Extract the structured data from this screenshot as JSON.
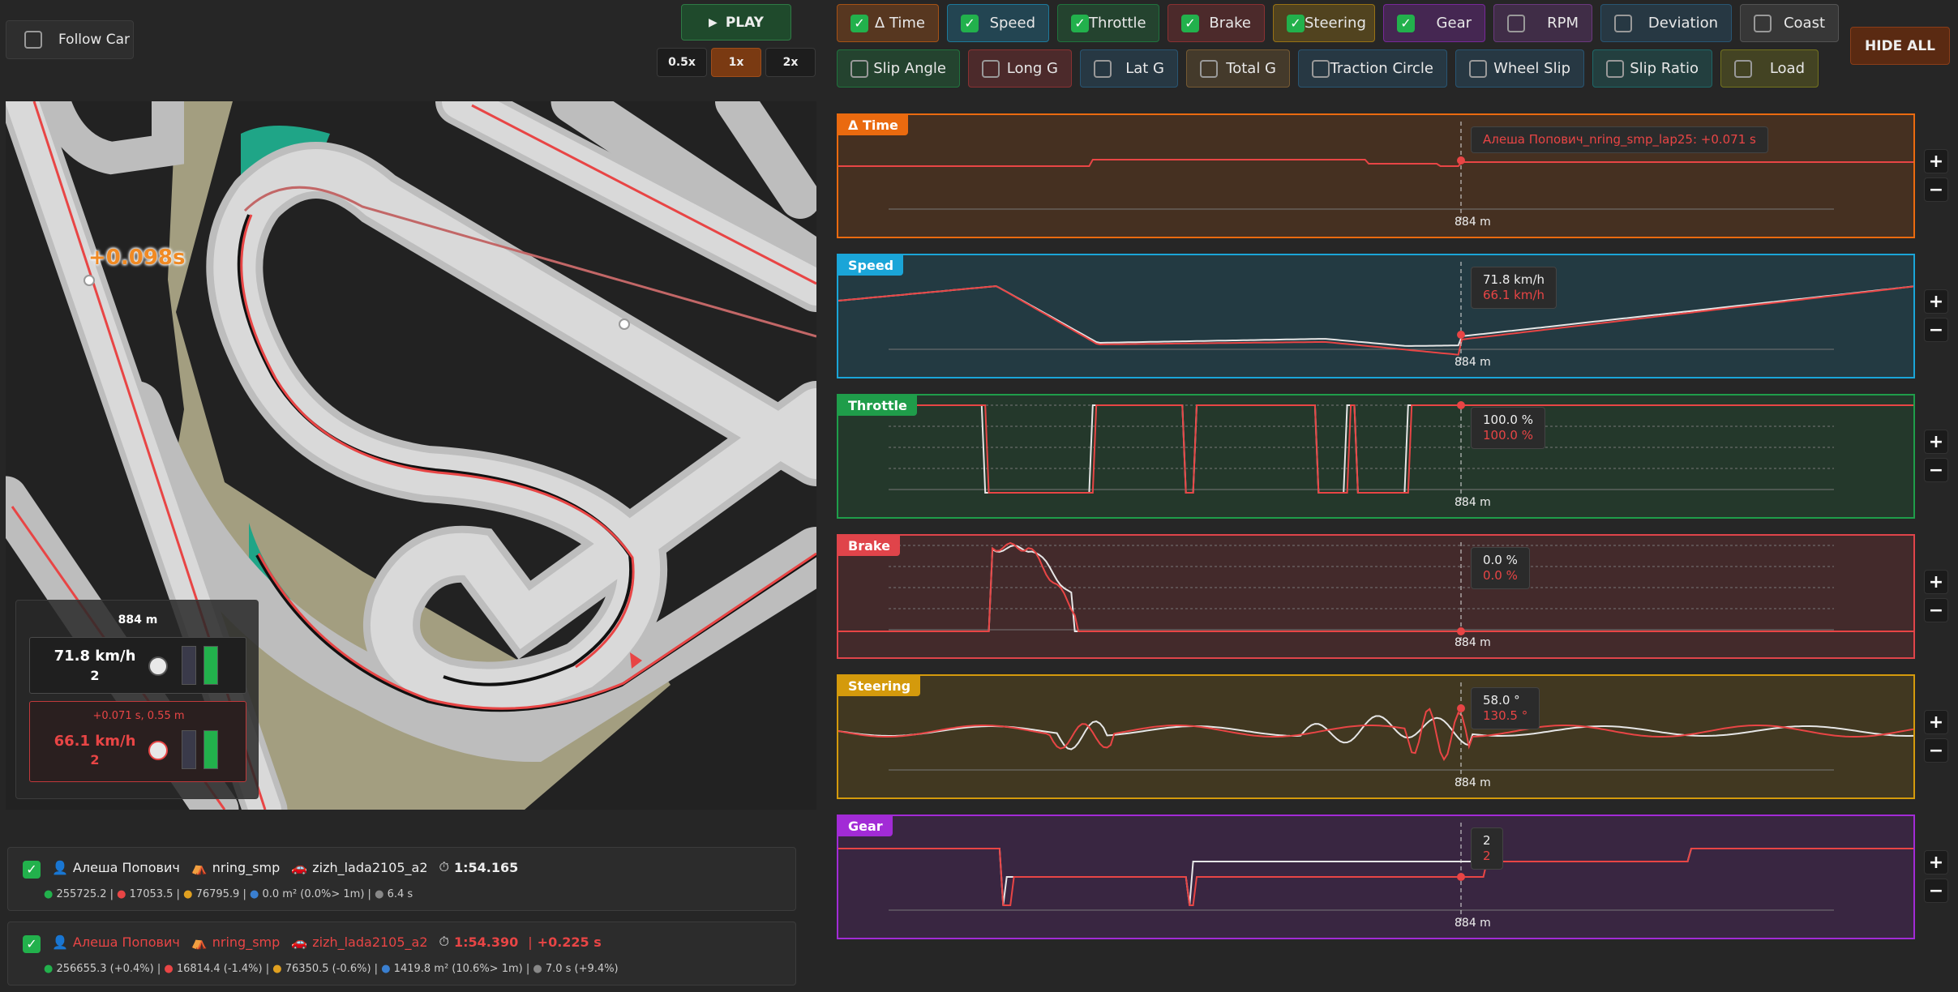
{
  "top_left": {
    "follow_car_label": "Follow Car",
    "follow_car_checked": false
  },
  "playback": {
    "play_label": "PLAY",
    "speeds": [
      "0.5x",
      "1x",
      "2x"
    ],
    "active_speed": "1x"
  },
  "toggles_row1": [
    {
      "label": "Δ Time",
      "checked": true,
      "color": "#ea6a0f"
    },
    {
      "label": "Speed",
      "checked": true,
      "color": "#1aa5d8"
    },
    {
      "label": "Throttle",
      "checked": true,
      "color": "#1f9d4a"
    },
    {
      "label": "Brake",
      "checked": true,
      "color": "#c0393b"
    },
    {
      "label": "Steering",
      "checked": true,
      "color": "#d49a0c"
    },
    {
      "label": "Gear",
      "checked": true,
      "color": "#a22bd6"
    },
    {
      "label": "RPM",
      "checked": false,
      "color": "#8e44ad"
    },
    {
      "label": "Deviation",
      "checked": false,
      "color": "#2c6f9c"
    },
    {
      "label": "Coast",
      "checked": false,
      "color": "#6b6b6b"
    }
  ],
  "toggles_row2": [
    {
      "label": "Slip Angle",
      "checked": false,
      "color": "#1f9d4a"
    },
    {
      "label": "Long G",
      "checked": false,
      "color": "#c0393b"
    },
    {
      "label": "Lat G",
      "checked": false,
      "color": "#2c6f9c"
    },
    {
      "label": "Total G",
      "checked": false,
      "color": "#a0763a"
    },
    {
      "label": "Traction Circle",
      "checked": false,
      "color": "#2c6f9c"
    },
    {
      "label": "Wheel Slip",
      "checked": false,
      "color": "#2c6f9c"
    },
    {
      "label": "Slip Ratio",
      "checked": false,
      "color": "#1a8a8a"
    },
    {
      "label": "Load",
      "checked": false,
      "color": "#9a9a1a"
    }
  ],
  "hide_all_label": "HIDE ALL",
  "map": {
    "delta_label": "+0.098s"
  },
  "hud": {
    "distance": "884 m",
    "ref_speed": "71.8 km/h",
    "ref_gear": "2",
    "cmp_delta": "+0.071 s, 0.55 m",
    "cmp_speed": "66.1 km/h",
    "cmp_gear": "2"
  },
  "panels": [
    {
      "key": "dtime",
      "title": "Δ Time",
      "color": "#ea6a0f",
      "distance": "884 m",
      "tip_lines": [
        "Алеша Попович_nring_smp_lap25: +0.071 s"
      ]
    },
    {
      "key": "speed",
      "title": "Speed",
      "color": "#1aa5d8",
      "distance": "884 m",
      "tip_lines": [
        "71.8 km/h",
        "66.1 km/h"
      ]
    },
    {
      "key": "throttle",
      "title": "Throttle",
      "color": "#1f9d4a",
      "distance": "884 m",
      "tip_lines": [
        "100.0 %",
        "100.0 %"
      ]
    },
    {
      "key": "brake",
      "title": "Brake",
      "color": "#e0444a",
      "distance": "884 m",
      "tip_lines": [
        "0.0 %",
        "0.0 %"
      ]
    },
    {
      "key": "steering",
      "title": "Steering",
      "color": "#d49a0c",
      "distance": "884 m",
      "tip_lines": [
        "58.0 °",
        "130.5 °"
      ]
    },
    {
      "key": "gear",
      "title": "Gear",
      "color": "#a22bd6",
      "distance": "884 m",
      "tip_lines": [
        "2",
        "2"
      ]
    }
  ],
  "laps": [
    {
      "checked": true,
      "driver": "Алеша Попович",
      "track": "nring_smp",
      "car": "zizh_lada2105_a2",
      "time": "1:54.165",
      "delta": "",
      "stats": [
        "255725.2",
        "17053.5",
        "76795.9",
        "0.0 m² (0.0%> 1m)",
        "6.4 s"
      ]
    },
    {
      "checked": true,
      "driver": "Алеша Попович",
      "track": "nring_smp",
      "car": "zizh_lada2105_a2",
      "time": "1:54.390",
      "delta": "+0.225 s",
      "stats": [
        "256655.3 (+0.4%)",
        "16814.4 (-1.4%)",
        "76350.5 (-0.6%)",
        "1419.8 m² (10.6%> 1m)",
        "7.0 s (+9.4%)"
      ]
    }
  ],
  "pm_labels": {
    "plus": "+",
    "minus": "−"
  }
}
